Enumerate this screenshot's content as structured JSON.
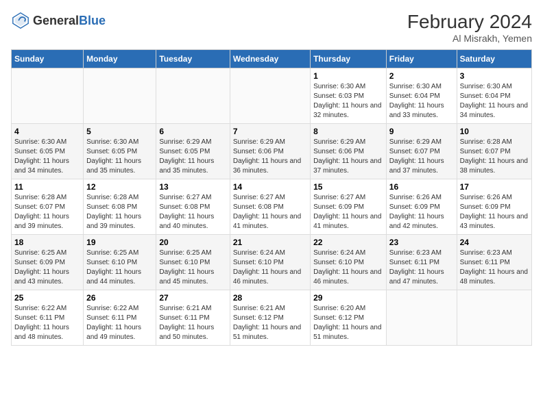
{
  "header": {
    "logo_general": "General",
    "logo_blue": "Blue",
    "title": "February 2024",
    "location": "Al Misrakh, Yemen"
  },
  "days_of_week": [
    "Sunday",
    "Monday",
    "Tuesday",
    "Wednesday",
    "Thursday",
    "Friday",
    "Saturday"
  ],
  "weeks": [
    [
      {
        "day": "",
        "info": ""
      },
      {
        "day": "",
        "info": ""
      },
      {
        "day": "",
        "info": ""
      },
      {
        "day": "",
        "info": ""
      },
      {
        "day": "1",
        "info": "Sunrise: 6:30 AM\nSunset: 6:03 PM\nDaylight: 11 hours and 32 minutes."
      },
      {
        "day": "2",
        "info": "Sunrise: 6:30 AM\nSunset: 6:04 PM\nDaylight: 11 hours and 33 minutes."
      },
      {
        "day": "3",
        "info": "Sunrise: 6:30 AM\nSunset: 6:04 PM\nDaylight: 11 hours and 34 minutes."
      }
    ],
    [
      {
        "day": "4",
        "info": "Sunrise: 6:30 AM\nSunset: 6:05 PM\nDaylight: 11 hours and 34 minutes."
      },
      {
        "day": "5",
        "info": "Sunrise: 6:30 AM\nSunset: 6:05 PM\nDaylight: 11 hours and 35 minutes."
      },
      {
        "day": "6",
        "info": "Sunrise: 6:29 AM\nSunset: 6:05 PM\nDaylight: 11 hours and 35 minutes."
      },
      {
        "day": "7",
        "info": "Sunrise: 6:29 AM\nSunset: 6:06 PM\nDaylight: 11 hours and 36 minutes."
      },
      {
        "day": "8",
        "info": "Sunrise: 6:29 AM\nSunset: 6:06 PM\nDaylight: 11 hours and 37 minutes."
      },
      {
        "day": "9",
        "info": "Sunrise: 6:29 AM\nSunset: 6:07 PM\nDaylight: 11 hours and 37 minutes."
      },
      {
        "day": "10",
        "info": "Sunrise: 6:28 AM\nSunset: 6:07 PM\nDaylight: 11 hours and 38 minutes."
      }
    ],
    [
      {
        "day": "11",
        "info": "Sunrise: 6:28 AM\nSunset: 6:07 PM\nDaylight: 11 hours and 39 minutes."
      },
      {
        "day": "12",
        "info": "Sunrise: 6:28 AM\nSunset: 6:08 PM\nDaylight: 11 hours and 39 minutes."
      },
      {
        "day": "13",
        "info": "Sunrise: 6:27 AM\nSunset: 6:08 PM\nDaylight: 11 hours and 40 minutes."
      },
      {
        "day": "14",
        "info": "Sunrise: 6:27 AM\nSunset: 6:08 PM\nDaylight: 11 hours and 41 minutes."
      },
      {
        "day": "15",
        "info": "Sunrise: 6:27 AM\nSunset: 6:09 PM\nDaylight: 11 hours and 41 minutes."
      },
      {
        "day": "16",
        "info": "Sunrise: 6:26 AM\nSunset: 6:09 PM\nDaylight: 11 hours and 42 minutes."
      },
      {
        "day": "17",
        "info": "Sunrise: 6:26 AM\nSunset: 6:09 PM\nDaylight: 11 hours and 43 minutes."
      }
    ],
    [
      {
        "day": "18",
        "info": "Sunrise: 6:25 AM\nSunset: 6:09 PM\nDaylight: 11 hours and 43 minutes."
      },
      {
        "day": "19",
        "info": "Sunrise: 6:25 AM\nSunset: 6:10 PM\nDaylight: 11 hours and 44 minutes."
      },
      {
        "day": "20",
        "info": "Sunrise: 6:25 AM\nSunset: 6:10 PM\nDaylight: 11 hours and 45 minutes."
      },
      {
        "day": "21",
        "info": "Sunrise: 6:24 AM\nSunset: 6:10 PM\nDaylight: 11 hours and 46 minutes."
      },
      {
        "day": "22",
        "info": "Sunrise: 6:24 AM\nSunset: 6:10 PM\nDaylight: 11 hours and 46 minutes."
      },
      {
        "day": "23",
        "info": "Sunrise: 6:23 AM\nSunset: 6:11 PM\nDaylight: 11 hours and 47 minutes."
      },
      {
        "day": "24",
        "info": "Sunrise: 6:23 AM\nSunset: 6:11 PM\nDaylight: 11 hours and 48 minutes."
      }
    ],
    [
      {
        "day": "25",
        "info": "Sunrise: 6:22 AM\nSunset: 6:11 PM\nDaylight: 11 hours and 48 minutes."
      },
      {
        "day": "26",
        "info": "Sunrise: 6:22 AM\nSunset: 6:11 PM\nDaylight: 11 hours and 49 minutes."
      },
      {
        "day": "27",
        "info": "Sunrise: 6:21 AM\nSunset: 6:11 PM\nDaylight: 11 hours and 50 minutes."
      },
      {
        "day": "28",
        "info": "Sunrise: 6:21 AM\nSunset: 6:12 PM\nDaylight: 11 hours and 51 minutes."
      },
      {
        "day": "29",
        "info": "Sunrise: 6:20 AM\nSunset: 6:12 PM\nDaylight: 11 hours and 51 minutes."
      },
      {
        "day": "",
        "info": ""
      },
      {
        "day": "",
        "info": ""
      }
    ]
  ]
}
